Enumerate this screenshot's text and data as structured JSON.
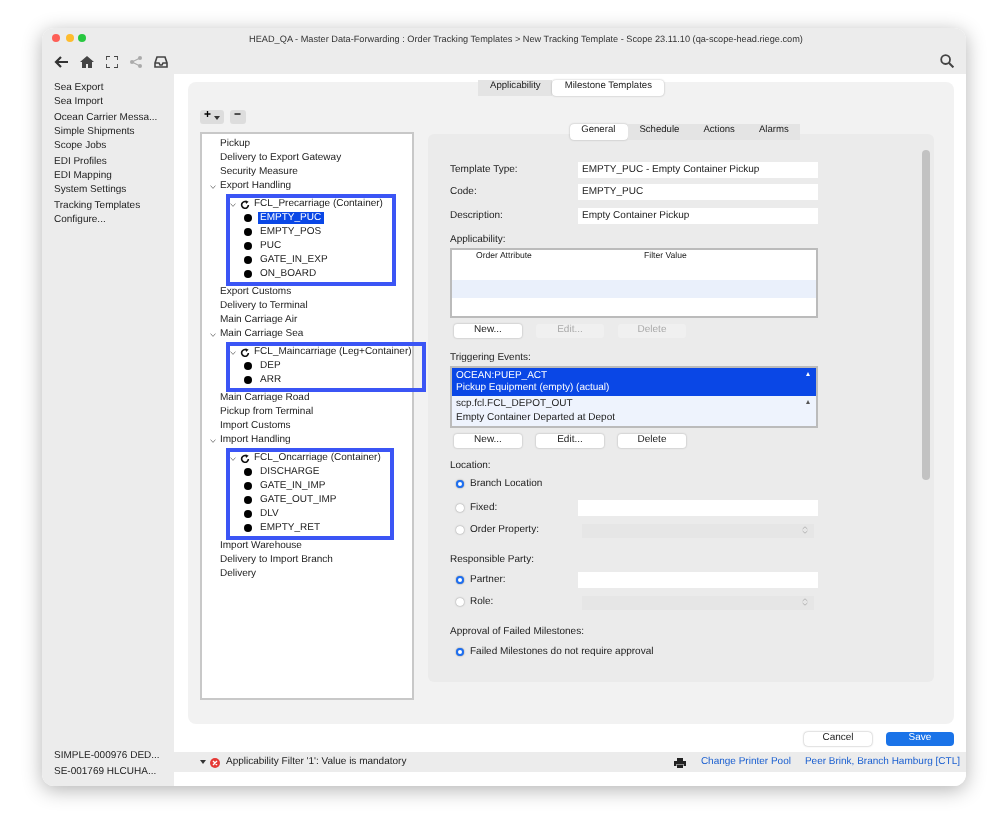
{
  "window": {
    "title": "HEAD_QA - Master Data-Forwarding : Order Tracking Templates > New Tracking Template - Scope 23.11.10 (qa-scope-head.riege.com)"
  },
  "sidebar": {
    "items": [
      "Sea Export",
      "Sea Import",
      "Ocean Carrier Messa...",
      "Simple Shipments",
      "Scope Jobs",
      "EDI Profiles",
      "EDI Mapping",
      "System Settings",
      "Tracking Templates",
      "Configure..."
    ],
    "recent": [
      "SIMPLE-000976 DED...",
      "SE-001769 HLCUHA..."
    ]
  },
  "main_tabs": [
    {
      "label": "Applicability",
      "selected": false
    },
    {
      "label": "Milestone Templates",
      "selected": true
    }
  ],
  "tree_toolbar": [
    {
      "label": "+",
      "has_menu": true
    },
    {
      "label": "−",
      "has_menu": false
    }
  ],
  "tree": [
    {
      "label": "Pickup",
      "selected": false
    },
    {
      "label": "Delivery to Export Gateway",
      "selected": false
    },
    {
      "label": "Security Measure",
      "selected": false
    },
    {
      "label": "Export Handling",
      "selected": false,
      "expanded": true,
      "children": [
        {
          "label": "FCL_Precarriage (Container)",
          "selected": false,
          "expanded": true,
          "highlighted": true,
          "children": [
            {
              "label": "EMPTY_PUC",
              "selected": true
            },
            {
              "label": "EMPTY_POS",
              "selected": false
            },
            {
              "label": "PUC",
              "selected": false
            },
            {
              "label": "GATE_IN_EXP",
              "selected": false
            },
            {
              "label": "ON_BOARD",
              "selected": false
            }
          ]
        }
      ]
    },
    {
      "label": "Export Customs",
      "selected": false
    },
    {
      "label": "Delivery to Terminal",
      "selected": false
    },
    {
      "label": "Main Carriage Air",
      "selected": false
    },
    {
      "label": "Main Carriage Sea",
      "selected": false,
      "expanded": true,
      "children": [
        {
          "label": "FCL_Maincarriage (Leg+Container)",
          "selected": false,
          "expanded": true,
          "highlighted": true,
          "children": [
            {
              "label": "DEP",
              "selected": false
            },
            {
              "label": "ARR",
              "selected": false
            }
          ]
        }
      ]
    },
    {
      "label": "Main Carriage Road",
      "selected": false
    },
    {
      "label": "Pickup from Terminal",
      "selected": false
    },
    {
      "label": "Import Customs",
      "selected": false
    },
    {
      "label": "Import Handling",
      "selected": false,
      "expanded": true,
      "children": [
        {
          "label": "FCL_Oncarriage (Container)",
          "selected": false,
          "expanded": true,
          "highlighted": true,
          "children": [
            {
              "label": "DISCHARGE",
              "selected": false
            },
            {
              "label": "GATE_IN_IMP",
              "selected": false
            },
            {
              "label": "GATE_OUT_IMP",
              "selected": false
            },
            {
              "label": "DLV",
              "selected": false
            },
            {
              "label": "EMPTY_RET",
              "selected": false
            }
          ]
        }
      ]
    },
    {
      "label": "Import Warehouse",
      "selected": false
    },
    {
      "label": "Delivery to Import Branch",
      "selected": false
    },
    {
      "label": "Delivery",
      "selected": false
    }
  ],
  "detail_tabs": [
    {
      "label": "General",
      "selected": true
    },
    {
      "label": "Schedule",
      "selected": false
    },
    {
      "label": "Actions",
      "selected": false
    },
    {
      "label": "Alarms",
      "selected": false
    }
  ],
  "fields": [
    {
      "label": "Template Type:",
      "value": "EMPTY_PUC - Empty Container Pickup"
    },
    {
      "label": "Code:",
      "value": "EMPTY_PUC"
    },
    {
      "label": "Description:",
      "value": "Empty Container Pickup"
    }
  ],
  "applicability": {
    "label": "Applicability:",
    "columns": [
      "Order Attribute",
      "Filter Value"
    ],
    "buttons": [
      {
        "label": "New...",
        "disabled": false
      },
      {
        "label": "Edit...",
        "disabled": true
      },
      {
        "label": "Delete",
        "disabled": true
      }
    ]
  },
  "triggering_events": {
    "label": "Triggering Events:",
    "events": [
      {
        "code": "OCEAN:PUEP_ACT",
        "description": "Pickup Equipment (empty) (actual)",
        "selected": true
      },
      {
        "code": "scp.fcl.FCL_DEPOT_OUT",
        "description": "Empty Container Departed at Depot",
        "selected": false
      }
    ],
    "buttons": [
      {
        "label": "New...",
        "disabled": false
      },
      {
        "label": "Edit...",
        "disabled": false
      },
      {
        "label": "Delete",
        "disabled": false
      }
    ]
  },
  "option_groups": [
    {
      "label": "Location:",
      "options": [
        {
          "label": "Branch Location",
          "kind": "plain",
          "selected": true
        },
        {
          "label": "Fixed:",
          "kind": "text",
          "selected": false
        },
        {
          "label": "Order Property:",
          "kind": "select",
          "selected": false
        }
      ]
    },
    {
      "label": "Responsible Party:",
      "options": [
        {
          "label": "Partner:",
          "kind": "text",
          "selected": true
        },
        {
          "label": "Role:",
          "kind": "select",
          "selected": false
        }
      ]
    },
    {
      "label": "Approval of Failed Milestones:",
      "options": [
        {
          "label": "Failed Milestones do not require approval",
          "kind": "plain",
          "selected": true
        }
      ]
    }
  ],
  "footer_buttons": [
    {
      "label": "Cancel",
      "kind": "secondary"
    },
    {
      "label": "Save",
      "kind": "primary"
    }
  ],
  "status_bar": {
    "message": "Applicability Filter '1': Value is mandatory",
    "links": [
      "Change Printer Pool",
      "Peer Brink, Branch Hamburg [CTL]"
    ]
  }
}
